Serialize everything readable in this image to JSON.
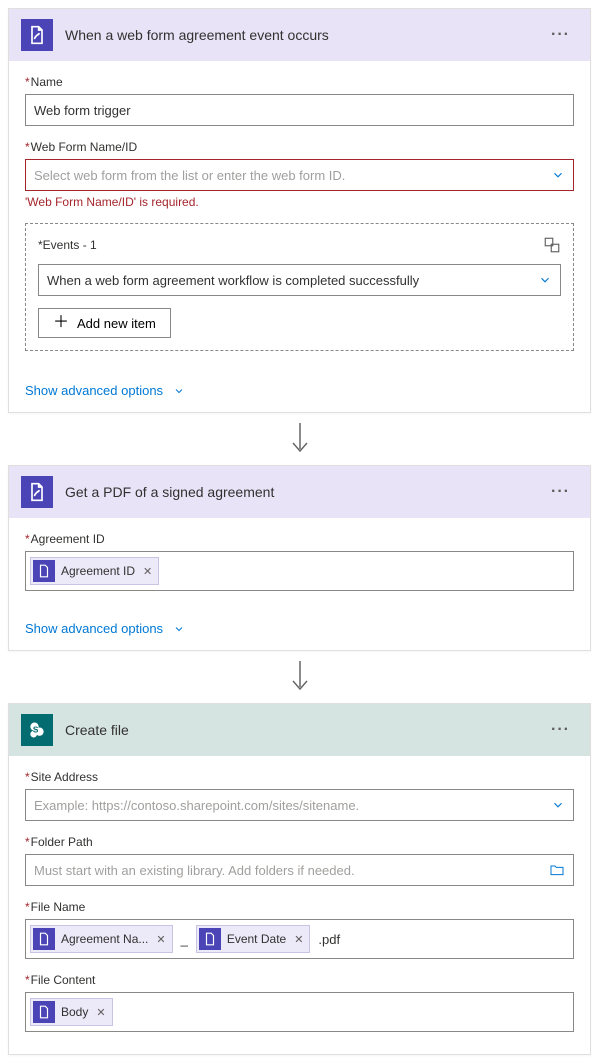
{
  "step1": {
    "title": "When a web form agreement event occurs",
    "name_label": "Name",
    "name_value": "Web form trigger",
    "webform_label": "Web Form Name/ID",
    "webform_placeholder": "Select web form from the list or enter the web form ID.",
    "webform_error": "'Web Form Name/ID' is required.",
    "events_label": "Events - 1",
    "events_value": "When a web form agreement workflow is completed successfully",
    "add_new": "Add new item",
    "advanced": "Show advanced options"
  },
  "step2": {
    "title": "Get a PDF of a signed agreement",
    "agreement_label": "Agreement ID",
    "token_agreement": "Agreement ID",
    "advanced": "Show advanced options"
  },
  "step3": {
    "title": "Create file",
    "site_label": "Site Address",
    "site_placeholder": "Example: https://contoso.sharepoint.com/sites/sitename.",
    "folder_label": "Folder Path",
    "folder_placeholder": "Must start with an existing library. Add folders if needed.",
    "filename_label": "File Name",
    "token_agreement_name": "Agreement Na...",
    "underscore": "_",
    "token_event_date": "Event Date",
    "pdf_ext": ".pdf",
    "filecontent_label": "File Content",
    "token_body": "Body"
  }
}
